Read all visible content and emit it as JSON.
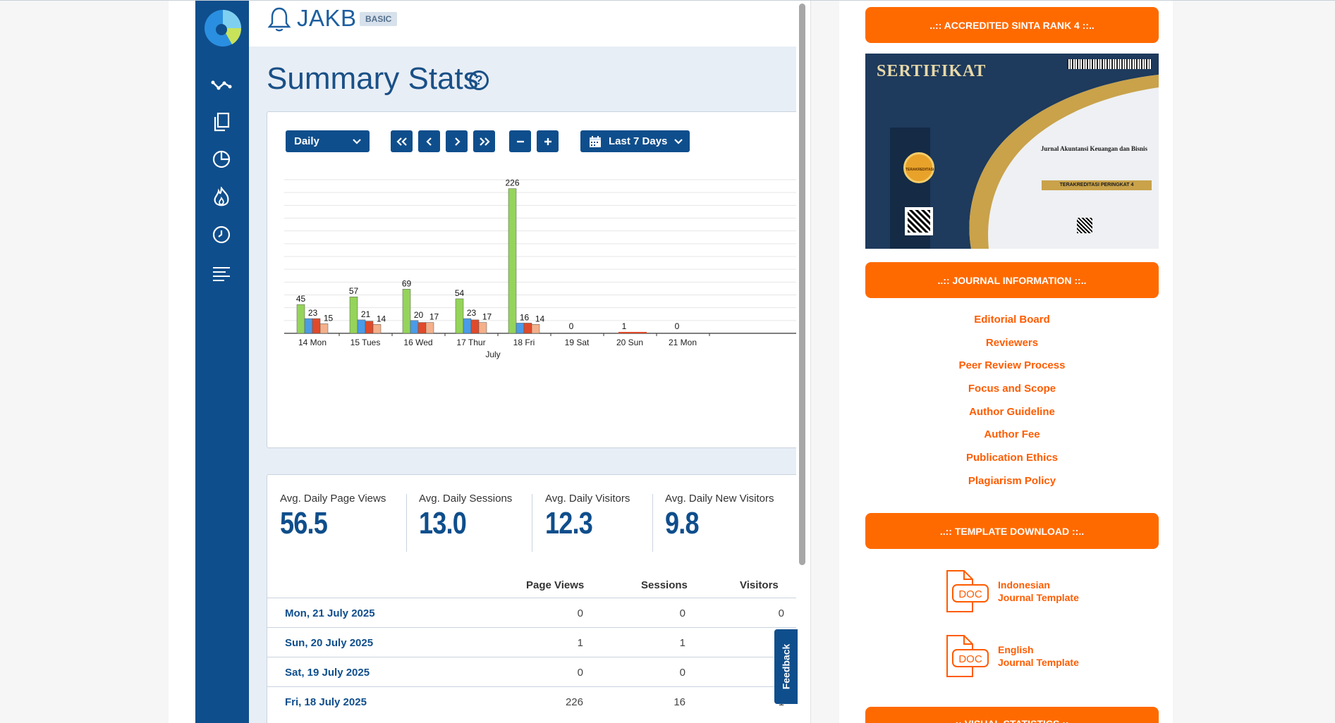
{
  "widget": {
    "site_name": "JAKB",
    "plan_badge": "BASIC",
    "title": "Summary Stats",
    "help_symbol": "?",
    "feedback_label": "Feedback",
    "controls": {
      "period": "Daily",
      "first": "«",
      "prev": "‹",
      "next": "›",
      "last": "»",
      "zoom_out": "−",
      "zoom_in": "+",
      "range": "Last 7 Days"
    },
    "colors": {
      "brand": "#0f4e8c",
      "page_views": "#95d45a",
      "sessions": "#4a9be8",
      "visitors": "#e04a2a",
      "new_visitors": "#f4b08a"
    },
    "summary": [
      {
        "label": "Avg. Daily Page Views",
        "value": "56.5"
      },
      {
        "label": "Avg. Daily Sessions",
        "value": "13.0"
      },
      {
        "label": "Avg. Daily Visitors",
        "value": "12.3"
      },
      {
        "label": "Avg. Daily New Visitors",
        "value": "9.8"
      }
    ],
    "table": {
      "headers": [
        "Page Views",
        "Sessions",
        "Visitors"
      ],
      "rows": [
        {
          "date": "Mon, 21 July 2025",
          "page_views": "0",
          "sessions": "0",
          "visitors": "0"
        },
        {
          "date": "Sun, 20 July 2025",
          "page_views": "1",
          "sessions": "1",
          "visitors": ""
        },
        {
          "date": "Sat, 19 July 2025",
          "page_views": "0",
          "sessions": "0",
          "visitors": ""
        },
        {
          "date": "Fri, 18 July 2025",
          "page_views": "226",
          "sessions": "16",
          "visitors": "1"
        }
      ]
    }
  },
  "chart_data": {
    "type": "bar",
    "categories": [
      "14 Mon",
      "15 Tues",
      "16 Wed",
      "17 Thur",
      "18 Fri",
      "19 Sat",
      "20 Sun",
      "21 Mon"
    ],
    "xlabel": "July",
    "series": [
      {
        "values": [
          45,
          57,
          69,
          54,
          226,
          0,
          1,
          0
        ]
      },
      {
        "values": [
          23,
          21,
          20,
          23,
          16,
          0,
          1,
          0
        ]
      },
      {
        "values": [
          23,
          19,
          17,
          21,
          16,
          0,
          1,
          0
        ]
      },
      {
        "values": [
          15,
          14,
          17,
          17,
          14,
          0,
          1,
          0
        ]
      }
    ],
    "data_labels": [
      [
        "45",
        "23",
        "15"
      ],
      [
        "57",
        "21",
        "14"
      ],
      [
        "69",
        "20",
        "17"
      ],
      [
        "54",
        "23",
        "17"
      ],
      [
        "226",
        "16",
        "14"
      ],
      [
        "0"
      ],
      [
        "1"
      ],
      [
        "0"
      ]
    ],
    "ylim": [
      0,
      240
    ],
    "grid": true
  },
  "sidebar": {
    "sinta_header": "..:: ACCREDITED SINTA RANK 4 ::..",
    "certificate": {
      "title": "SERTIFIKAT",
      "journal": "Jurnal Akuntansi Keuangan dan Bisnis",
      "rank": "TERAKREDITASI PERINGKAT 4",
      "seal": "TERAKREDITASI"
    },
    "info_header": "..:: JOURNAL INFORMATION ::..",
    "info_links": [
      "Editorial Board",
      "Reviewers",
      "Peer Review Process",
      "Focus and Scope",
      "Author Guideline",
      "Author Fee",
      "Publication Ethics",
      "Plagiarism Policy"
    ],
    "template_header": "..:: TEMPLATE DOWNLOAD ::..",
    "templates": [
      {
        "line1": "Indonesian",
        "line2": "Journal Template",
        "icon": "DOC"
      },
      {
        "line1": "English",
        "line2": "Journal Template",
        "icon": "DOC"
      }
    ],
    "visual_header": "..:: VISUAL STATISTICS ::.."
  }
}
